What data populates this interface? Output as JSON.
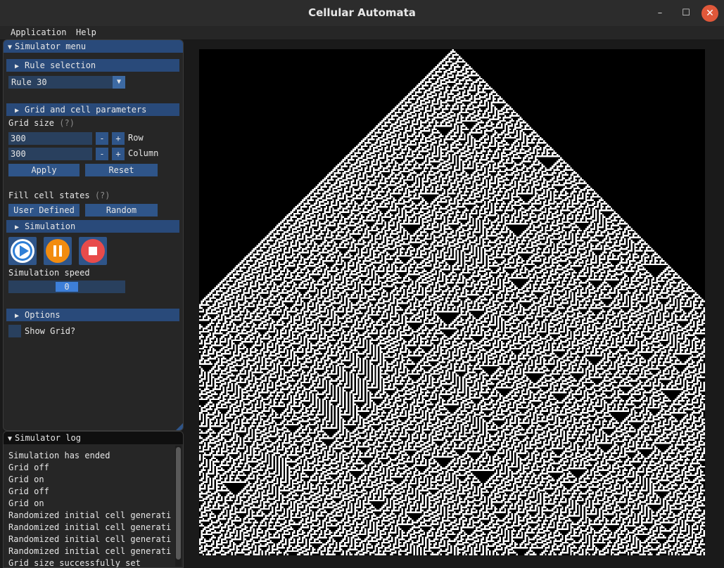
{
  "window": {
    "title": "Cellular Automata",
    "minimize_icon": "–",
    "maximize_icon": "☐",
    "close_icon": "✕"
  },
  "menubar": {
    "items": [
      "Application",
      "Help"
    ]
  },
  "simulator_menu": {
    "title": "Simulator menu",
    "rule_section": {
      "header": "Rule selection",
      "selected_rule": "Rule 30"
    },
    "grid_section": {
      "header": "Grid and cell parameters",
      "grid_size_label": "Grid size",
      "help_marker": "(?)",
      "rows_value": "300",
      "rows_label": "Row",
      "columns_value": "300",
      "columns_label": "Column",
      "minus": "-",
      "plus": "+",
      "apply_label": "Apply",
      "reset_label": "Reset",
      "fill_label": "Fill cell states",
      "user_defined_label": "User Defined",
      "random_label": "Random"
    },
    "simulation_section": {
      "header": "Simulation",
      "speed_label": "Simulation speed",
      "speed_value": "0",
      "controls": [
        "play-icon",
        "pause-icon",
        "stop-icon"
      ],
      "colors": {
        "play": "#2f7fd6",
        "pause": "#f28c0f",
        "stop": "#e84b4b"
      }
    },
    "options_section": {
      "header": "Options",
      "show_grid_label": "Show Grid?",
      "show_grid_checked": false
    }
  },
  "simulator_log": {
    "title": "Simulator log",
    "lines": [
      "Simulation has ended",
      "Grid off",
      "Grid on",
      "Grid off",
      "Grid on",
      "Randomized initial cell generatio",
      "Randomized initial cell generatio",
      "Randomized initial cell generatio",
      "Randomized initial cell generatio",
      "Grid size successfully set"
    ]
  },
  "automaton": {
    "rule": 30,
    "rows": 300,
    "columns": 300,
    "initial": "single-center-cell"
  },
  "colors": {
    "accent": "#294a7a",
    "button": "#2f5589",
    "frame": "#262626",
    "alive": "#000000",
    "dead": "#ffffff"
  }
}
